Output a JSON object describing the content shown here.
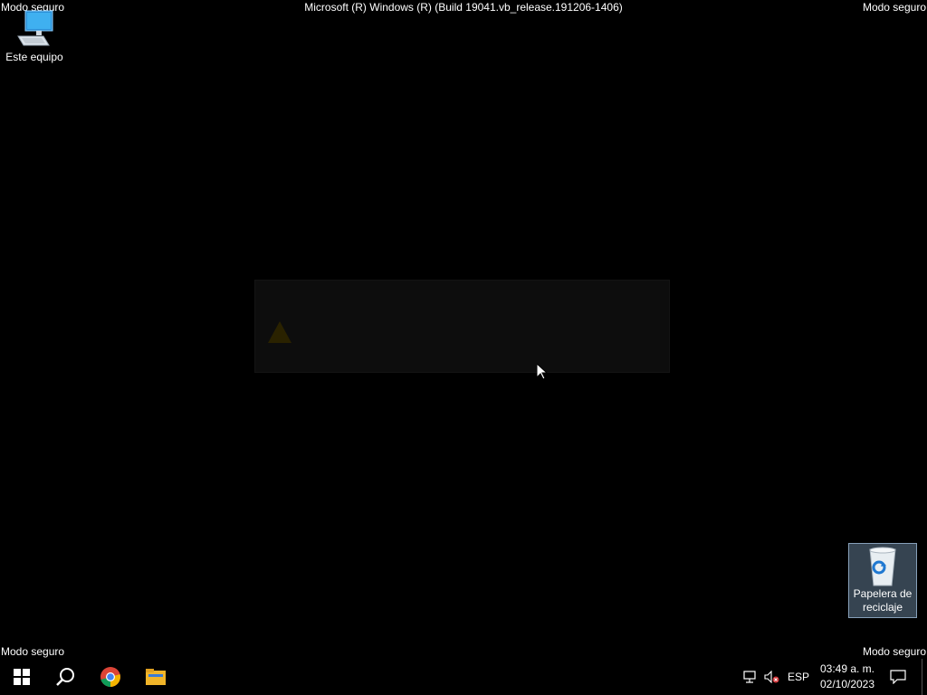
{
  "watermark": {
    "top_left": "Modo seguro",
    "top_right": "Modo seguro",
    "bottom_left": "Modo seguro",
    "bottom_right": "Modo seguro",
    "build": "Microsoft (R) Windows (R) (Build 19041.vb_release.191206-1406)"
  },
  "desktop": {
    "this_pc_label": "Este equipo",
    "recycle_bin_label": "Papelera de reciclaje"
  },
  "dialog": {
    "title": "",
    "message": ""
  },
  "taskbar": {
    "icons": [
      "windows-start-icon",
      "search-icon",
      "chrome-icon",
      "file-explorer-icon"
    ],
    "language": "ESP",
    "time": "03:49 a. m.",
    "date": "02/10/2023"
  }
}
